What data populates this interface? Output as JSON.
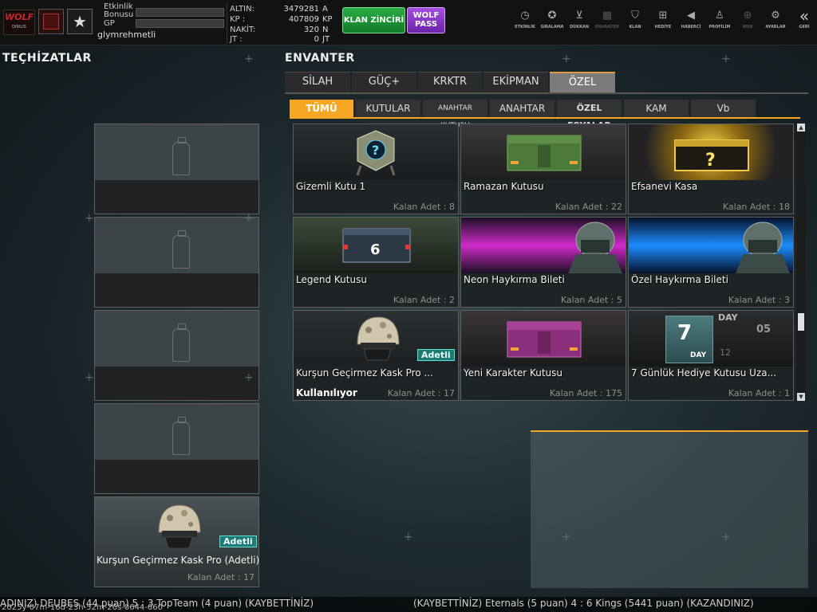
{
  "topbar": {
    "event_bonus_label": "Etkinlik Bonusu",
    "gp_label": "GP",
    "username": "glymrehmetli",
    "clan_logo_text": "WOLF",
    "clan_logo_sub": "DIRILIS",
    "currency": [
      {
        "label": "ALTIN:",
        "value": "3479281",
        "unit": "A"
      },
      {
        "label": "KP   :",
        "value": "407809",
        "unit": "KP"
      },
      {
        "label": "NAKİT:",
        "value": "320",
        "unit": "N"
      },
      {
        "label": "JT   :",
        "value": "0",
        "unit": "JT"
      }
    ],
    "klan_button": "KLAN ZİNCİRİ",
    "wolf_pass_line1": "WOLF",
    "wolf_pass_line2": "PASS",
    "nav": [
      {
        "label": "ETKİNLİK",
        "icon": "stopwatch-icon"
      },
      {
        "label": "SIRALAMA",
        "icon": "medal-icon"
      },
      {
        "label": "DÜKKAN",
        "icon": "cart-icon"
      },
      {
        "label": "ENVANTER",
        "icon": "inventory-icon"
      },
      {
        "label": "KLAN",
        "icon": "shield-icon"
      },
      {
        "label": "HEDİYE",
        "icon": "gift-icon"
      },
      {
        "label": "HABERCİ",
        "icon": "megaphone-icon"
      },
      {
        "label": "PROFİLİM",
        "icon": "profile-icon"
      },
      {
        "label": "WEB",
        "icon": "globe-icon"
      },
      {
        "label": "AYARLAR",
        "icon": "gear-icon"
      },
      {
        "label": "GERİ",
        "icon": "back-chevron-icon"
      }
    ]
  },
  "equipment": {
    "title": "TEÇHİZATLAR",
    "last_slot": {
      "name": "Kurşun Geçirmez Kask Pro (Adetli)",
      "badge": "Adetli",
      "count": "Kalan Adet : 17"
    }
  },
  "inventory": {
    "title": "ENVANTER",
    "tabs": [
      "SİLAH",
      "GÜÇ+",
      "KRKTR",
      "EKİPMAN",
      "ÖZEL"
    ],
    "active_tab": "ÖZEL",
    "subtabs": [
      "TÜMÜ",
      "KUTULAR",
      "ANAHTAR KUTUSU",
      "ANAHTAR",
      "ÖZEL EŞYALAR",
      "KAM",
      "Vb"
    ],
    "active_subtab": "TÜMÜ",
    "items": [
      {
        "name": "Gizemli Kutu 1",
        "count": "Kalan Adet : 8"
      },
      {
        "name": "Ramazan Kutusu",
        "count": "Kalan Adet : 22"
      },
      {
        "name": "Efsanevi Kasa",
        "count": "Kalan Adet : 18"
      },
      {
        "name": "Legend Kutusu",
        "count": "Kalan Adet : 2"
      },
      {
        "name": "Neon Haykırma Bileti",
        "count": "Kalan Adet : 5"
      },
      {
        "name": "Özel Haykırma Bileti",
        "count": "Kalan Adet : 3"
      },
      {
        "name": "Kurşun Geçirmez Kask Pro ...",
        "count": "Kalan Adet : 17",
        "badge": "Adetli",
        "status": "Kullanılıyor"
      },
      {
        "name": "Yeni Karakter Kutusu",
        "count": "Kalan Adet : 175"
      },
      {
        "name": "7 Günlük Hediye Kutusu Uza...",
        "count": "Kalan Adet : 1"
      }
    ],
    "legend_box_number": "6",
    "day_box": {
      "big": "7",
      "day": "DAY",
      "top": "DAY",
      "side1": "05",
      "side2": "12"
    }
  },
  "ticker": {
    "left": "ADINIZ) DEUBES (44 puan) 5 : 3 TopTeam (4 puan) (KAYBETTİNİZ)",
    "right": "(KAYBETTİNİZ) Eternals (5 puan) 4 : 6 Kings (5441 puan) (KAZANDINIZ)",
    "timestamp": "2025y-07m-16d-23h-52m-26s-0644-660"
  }
}
